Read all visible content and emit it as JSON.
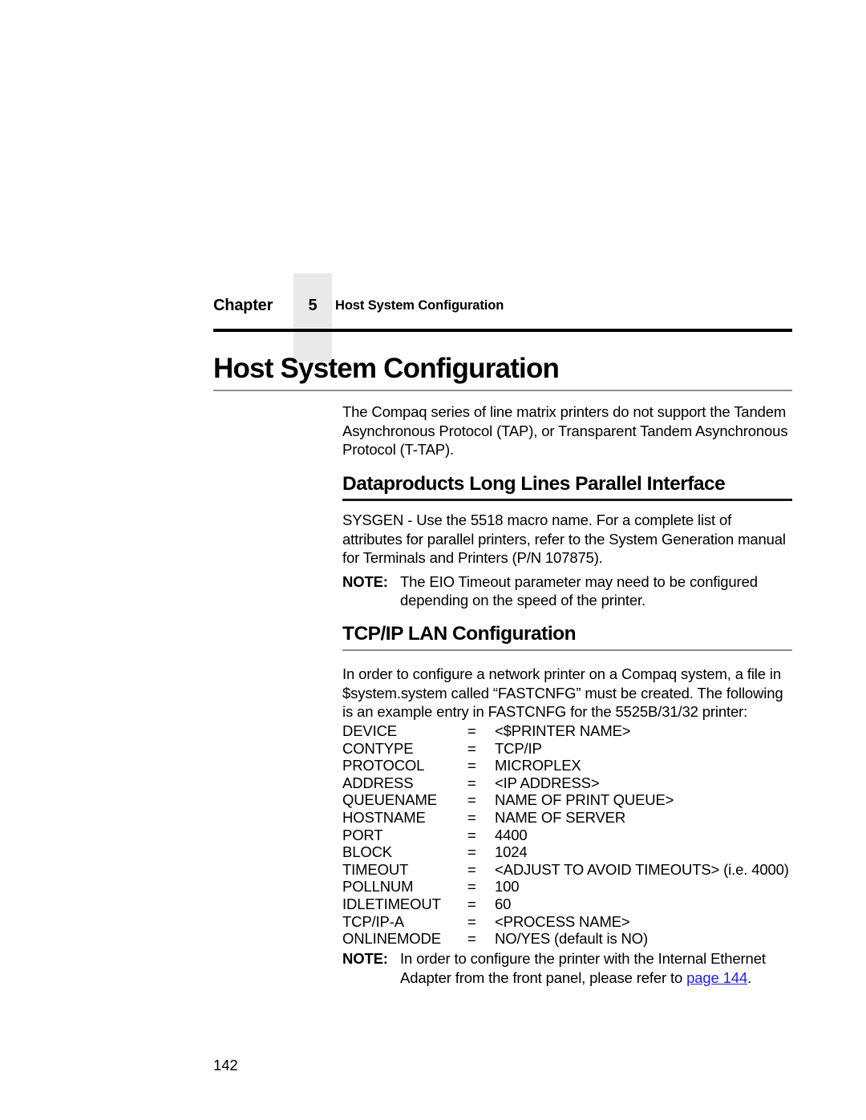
{
  "running_head": {
    "chapter_word": "Chapter",
    "chapter_number": "5",
    "title": "Host System Configuration"
  },
  "document_title": "Host System Configuration",
  "intro_paragraph": "The Compaq series of line matrix printers do not support the Tandem Asynchronous Protocol (TAP), or Transparent Tandem Asynchronous Protocol (T-TAP).",
  "section_dataproducts": {
    "heading": "Dataproducts Long Lines Parallel Interface",
    "paragraph": "SYSGEN - Use the 5518 macro name. For a complete list of attributes for parallel printers, refer to the System Generation manual for Terminals and Printers (P/N 107875).",
    "note_label": "NOTE:",
    "note_text": "The EIO Timeout parameter may need to be configured depending on the speed of the printer."
  },
  "section_tcpip": {
    "heading": "TCP/IP LAN Configuration",
    "paragraph": "In order to configure a network printer on a Compaq system, a file in $system.system called “FASTCNFG” must be created. The following is an example entry in FASTCNFG for the 5525B/31/32 printer:",
    "config_rows": [
      {
        "key": "DEVICE",
        "eq": "=",
        "value": "<$PRINTER NAME>"
      },
      {
        "key": "CONTYPE",
        "eq": "=",
        "value": "TCP/IP"
      },
      {
        "key": "PROTOCOL",
        "eq": "=",
        "value": "MICROPLEX"
      },
      {
        "key": "ADDRESS",
        "eq": "=",
        "value": "<IP ADDRESS>"
      },
      {
        "key": "QUEUENAME",
        "eq": "=",
        "value": "NAME OF PRINT QUEUE>"
      },
      {
        "key": "HOSTNAME",
        "eq": "=",
        "value": "NAME OF SERVER"
      },
      {
        "key": "PORT",
        "eq": "=",
        "value": "4400"
      },
      {
        "key": "BLOCK",
        "eq": "=",
        "value": "1024"
      },
      {
        "key": "TIMEOUT",
        "eq": "=",
        "value": "<ADJUST TO AVOID TIMEOUTS> (i.e. 4000)"
      },
      {
        "key": "POLLNUM",
        "eq": "=",
        "value": "100"
      },
      {
        "key": "IDLETIMEOUT",
        "eq": "=",
        "value": "60"
      },
      {
        "key": "TCP/IP-A",
        "eq": "=",
        "value": "<PROCESS NAME>"
      },
      {
        "key": "ONLINEMODE",
        "eq": "=",
        "value": "NO/YES (default is NO)"
      }
    ],
    "note_label": "NOTE:",
    "note_text_before_link": "In order to configure the printer with the Internal Ethernet Adapter from the front panel, please refer to ",
    "note_link_text": "page 144",
    "note_text_after_link": ".",
    "link_color": "#2222dd"
  },
  "folio": "142"
}
